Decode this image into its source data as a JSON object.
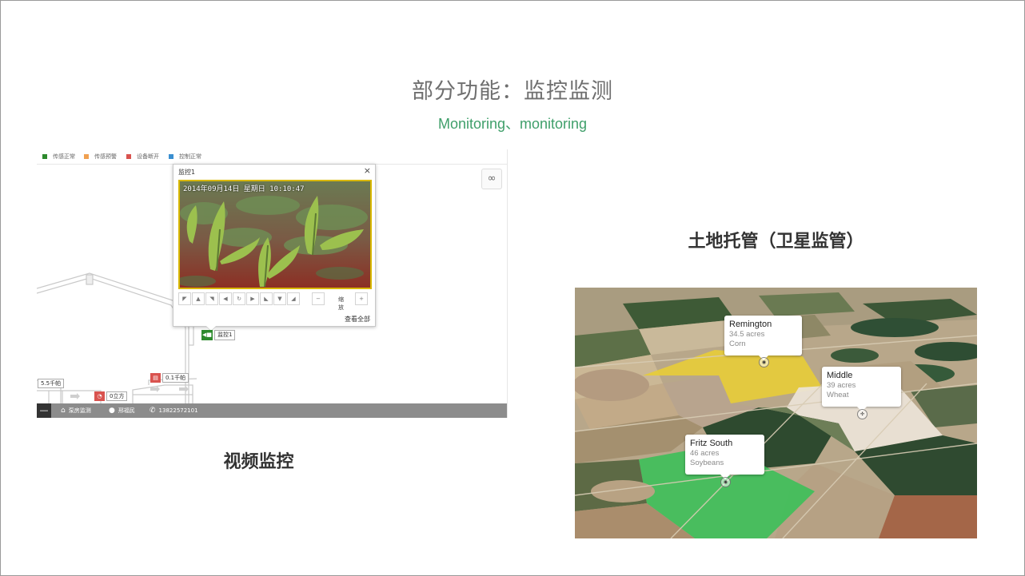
{
  "header": {
    "title": "部分功能：监控监测",
    "subtitle": "Monitoring、monitoring"
  },
  "monitor": {
    "legend": [
      {
        "label": "传感正常",
        "color": "#2d8a2d"
      },
      {
        "label": "传感预警",
        "color": "#f0a050"
      },
      {
        "label": "设备断开",
        "color": "#d9534f"
      },
      {
        "label": "控制正常",
        "color": "#3a8fd0"
      }
    ],
    "popup": {
      "title": "监控1",
      "close": "×",
      "timestamp": "2014年09月14日 星期日 10:10:47",
      "zoom_label": "缩放",
      "zoom_minus": "−",
      "zoom_plus": "+",
      "view_all": "查看全部"
    },
    "camera_marker": "监控1",
    "sensors": {
      "power_top": "0.1千帕",
      "volume": "0立方",
      "pressure_left": "5.5千帕"
    },
    "statusbar": {
      "minus": "—",
      "location": "泵房监测",
      "person": "邢福民",
      "phone": "13822572101"
    },
    "caption": "视频监控"
  },
  "satellite": {
    "caption": "土地托管（卫星监管）",
    "fields": [
      {
        "name": "Remington",
        "acres": "34.5 acres",
        "crop": "Corn"
      },
      {
        "name": "Middle",
        "acres": "39 acres",
        "crop": "Wheat"
      },
      {
        "name": "Fritz South",
        "acres": "46 acres",
        "crop": "Soybeans"
      }
    ]
  },
  "colors": {
    "accent_green": "#3f9f6a",
    "corn_field": "#e6cc3a",
    "wheat_field": "#e8e2d8",
    "soy_field": "#3fbf5a"
  }
}
